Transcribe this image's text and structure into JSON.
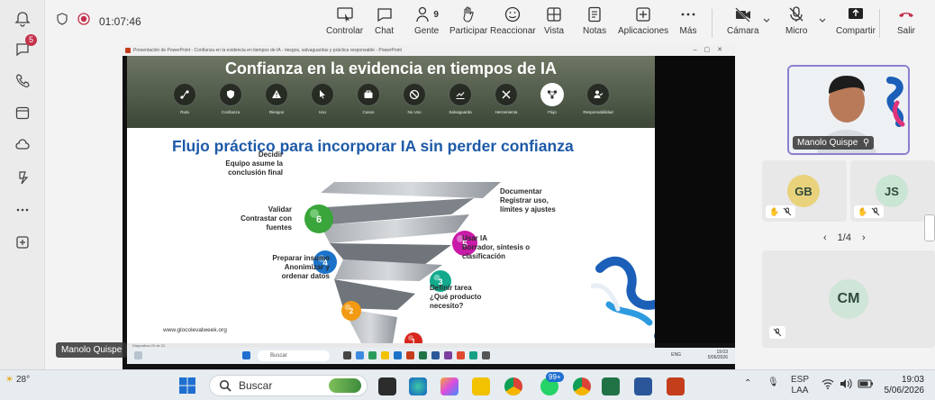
{
  "meeting": {
    "timer": "01:07:46"
  },
  "rail": {
    "chat_badge": "5"
  },
  "toolbar": {
    "controlar": "Controlar",
    "chat": "Chat",
    "gente": "Gente",
    "gente_count": "9",
    "participar": "Participar",
    "reaccionar": "Reaccionar",
    "vista": "Vista",
    "notas": "Notas",
    "aplicaciones": "Aplicaciones",
    "mas": "Más",
    "camara": "Cámara",
    "micro": "Micro",
    "compartir": "Compartir",
    "salir": "Salir"
  },
  "shared_window": {
    "title_bar": "Presentación de PowerPoint  -  Confianza en la evidencia en tiempos de IA - riesgos, salvaguardas y práctica responsable - PowerPoint",
    "status_text": "Diapositiva 20 de 22"
  },
  "slide": {
    "title": "Confianza en la evidencia en tiempos de IA",
    "nav": [
      {
        "label": "Ruta"
      },
      {
        "label": "Confianza"
      },
      {
        "label": "Riesgos"
      },
      {
        "label": "Uso"
      },
      {
        "label": "Casos"
      },
      {
        "label": "No Uso"
      },
      {
        "label": "Salvaguarda"
      },
      {
        "label": "Herramienta"
      },
      {
        "label": "Flujo"
      },
      {
        "label": "Responsabilidad"
      }
    ],
    "subtitle": "Flujo práctico para incorporar IA sin perder confianza",
    "steps": [
      {
        "num": "1",
        "text_1": "Definir tarea",
        "text_2": "¿Qué producto",
        "text_3": "necesito?",
        "color": "#d7261e"
      },
      {
        "num": "2",
        "text_1": "Preparar insumo",
        "text_2": "Anonimizar y",
        "text_3": "ordenar datos",
        "color": "#f29a12"
      },
      {
        "num": "3",
        "text_1": "Usar IA",
        "text_2": "Borrador, síntesis o",
        "text_3": "clasificación",
        "color": "#12a98d"
      },
      {
        "num": "4",
        "text_1": "Validar",
        "text_2": "Contrastar con",
        "text_3": "fuentes",
        "color": "#1b73c9"
      },
      {
        "num": "5",
        "text_1": "Documentar",
        "text_2": "Registrar uso,",
        "text_3": "límites y ajustes",
        "color": "#c81aa8"
      },
      {
        "num": "6",
        "text_1": "Decidir",
        "text_2": "Equipo asume la",
        "text_3": "conclusión final",
        "color": "#3aa53a"
      }
    ],
    "url": "www.glocolevalweek.org"
  },
  "remote_taskbar": {
    "search": "Buscar",
    "lang": "ENG",
    "time": "19:03",
    "date": "5/06/2026"
  },
  "presenter_tag": "Manolo Quispe",
  "panel": {
    "speaker_name": "Manolo Quispe",
    "participants": [
      {
        "initials": "GB"
      },
      {
        "initials": "JS"
      },
      {
        "initials": "CM"
      }
    ],
    "pager": "1/4"
  },
  "taskbar": {
    "temperature": "28°",
    "search": "Buscar",
    "whatsapp_badge": "99+",
    "lang_1": "ESP",
    "lang_2": "LAA",
    "time": "19:03",
    "date": "5/06/2026"
  },
  "colors": {
    "accent_purple": "#8a7fd0",
    "leave_red": "#c4314b",
    "slide_blue": "#1d5aa8"
  }
}
